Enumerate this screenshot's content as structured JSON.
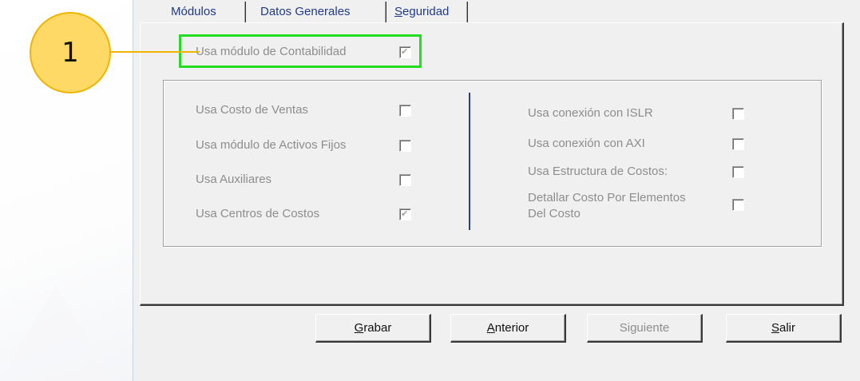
{
  "tabs": [
    {
      "label": "Módulos"
    },
    {
      "label": "Datos Generales"
    },
    {
      "label_first": "S",
      "label_rest": "eguridad"
    }
  ],
  "main_option": {
    "label": "Usa módulo de Contabilidad",
    "checked": true
  },
  "left_options": [
    {
      "label": "Usa Costo de Ventas",
      "checked": false
    },
    {
      "label": "Usa módulo de Activos Fijos",
      "checked": false
    },
    {
      "label": "Usa Auxiliares",
      "checked": false
    },
    {
      "label": "Usa Centros de Costos",
      "checked": true
    }
  ],
  "right_options": [
    {
      "label": "Usa conexión con ISLR",
      "checked": false
    },
    {
      "label": "Usa conexión con AXI",
      "checked": false
    },
    {
      "label": "Usa Estructura de Costos:",
      "checked": false
    },
    {
      "label_line1": "Detallar Costo Por Elementos",
      "label_line2": "Del Costo",
      "checked": false
    }
  ],
  "buttons": {
    "grabar": {
      "first": "G",
      "rest": "rabar"
    },
    "anterior": {
      "first": "A",
      "rest": "nterior"
    },
    "siguiente": {
      "first": "Si",
      "u": "g",
      "rest": "uiente"
    },
    "salir": {
      "first": "S",
      "rest": "alir"
    }
  },
  "callout": {
    "number": "1"
  },
  "colors": {
    "tab_text": "#1f3a8a",
    "highlight": "#22dd22",
    "callout_fill": "#ffd966",
    "callout_border": "#f0b400",
    "divider": "#2b3d8f"
  }
}
